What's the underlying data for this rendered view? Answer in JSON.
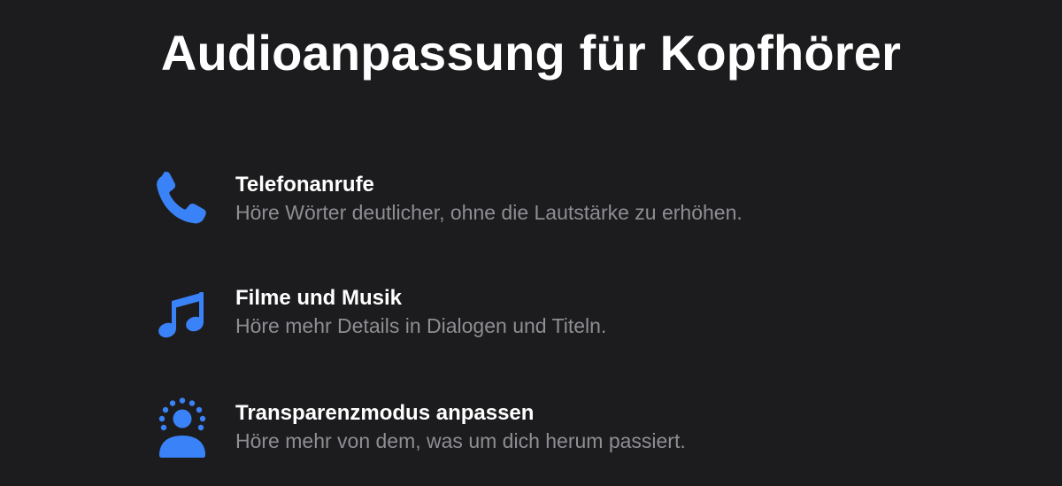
{
  "page": {
    "title": "Audioanpassung für Kopfhörer",
    "accent_color": "#3a82f7",
    "background_color": "#1c1c1e"
  },
  "features": [
    {
      "icon": "phone-icon",
      "title": "Telefonanrufe",
      "description": "Höre Wörter deutlicher, ohne die Lautstärke zu erhöhen."
    },
    {
      "icon": "music-note-icon",
      "title": "Filme und Musik",
      "description": "Höre mehr Details in Dialogen und Titeln."
    },
    {
      "icon": "transparency-person-icon",
      "title": "Transparenzmodus anpassen",
      "description": "Höre mehr von dem, was um dich herum passiert."
    }
  ]
}
